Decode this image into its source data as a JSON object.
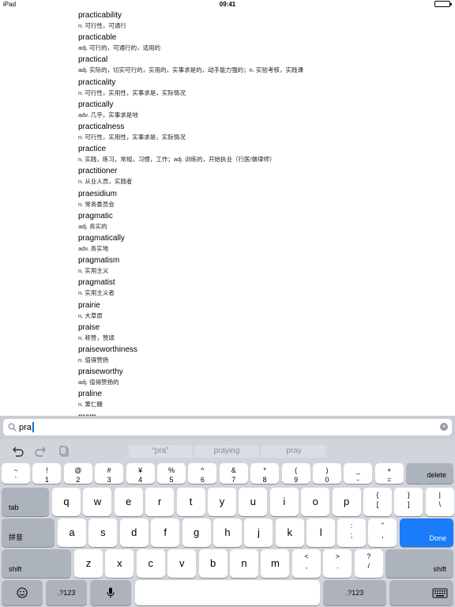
{
  "status": {
    "device": "iPad",
    "time": "09:41"
  },
  "entries": [
    {
      "word": "practicability",
      "def": "n. 可行性，可通行"
    },
    {
      "word": "practicable",
      "def": "adj. 可行的，可通行的，适用的"
    },
    {
      "word": "practical",
      "def": "adj. 实际的，切实可行的，实用的，实事求是的，动手能力强的；n. 实验考核，实践课"
    },
    {
      "word": "practicality",
      "def": "n. 可行性，实用性，实事求是，实际情况"
    },
    {
      "word": "practically",
      "def": "adv. 几乎，实事求是地"
    },
    {
      "word": "practicalness",
      "def": "n. 可行性，实用性，实事求是，实际情况"
    },
    {
      "word": "practice",
      "def": "n. 实践，练习，常规，习惯，工作；adj. 训练的，开始执业（行医/做律师）"
    },
    {
      "word": "practitioner",
      "def": "n. 从业人员，实践者"
    },
    {
      "word": "praesidium",
      "def": "n. 常务委员会"
    },
    {
      "word": "pragmatic",
      "def": "adj. 务实的"
    },
    {
      "word": "pragmatically",
      "def": "adv. 务实地"
    },
    {
      "word": "pragmatism",
      "def": "n. 实用主义"
    },
    {
      "word": "pragmatist",
      "def": "n. 实用主义者"
    },
    {
      "word": "prairie",
      "def": "n. 大草原"
    },
    {
      "word": "praise",
      "def": "n. 称赞，赞颂"
    },
    {
      "word": "praiseworthiness",
      "def": "n. 值得赞扬"
    },
    {
      "word": "praiseworthy",
      "def": "adj. 值得赞扬的"
    },
    {
      "word": "praline",
      "def": "n. 果仁糖"
    },
    {
      "word": "pram",
      "def": ""
    }
  ],
  "search": {
    "value": "pra"
  },
  "candidates": [
    "“pra”",
    "praying",
    "pray"
  ],
  "keyboard": {
    "row1": [
      {
        "top": "~",
        "bottom": "`"
      },
      {
        "top": "!",
        "bottom": "1"
      },
      {
        "top": "@",
        "bottom": "2"
      },
      {
        "top": "#",
        "bottom": "3"
      },
      {
        "top": "¥",
        "bottom": "4"
      },
      {
        "top": "%",
        "bottom": "5"
      },
      {
        "top": "^",
        "bottom": "6"
      },
      {
        "top": "&",
        "bottom": "7"
      },
      {
        "top": "*",
        "bottom": "8"
      },
      {
        "top": "(",
        "bottom": "9"
      },
      {
        "top": ")",
        "bottom": "0"
      },
      {
        "top": "_",
        "bottom": "-"
      },
      {
        "top": "+",
        "bottom": "="
      }
    ],
    "delete": "delete",
    "tab": "tab",
    "row2": [
      "q",
      "w",
      "e",
      "r",
      "t",
      "y",
      "u",
      "i",
      "o",
      "p"
    ],
    "row2_extra": [
      {
        "top": "{",
        "bottom": "["
      },
      {
        "top": "}",
        "bottom": "]"
      },
      {
        "top": "|",
        "bottom": "\\"
      }
    ],
    "pinyin": "拼音",
    "row3": [
      "a",
      "s",
      "d",
      "f",
      "g",
      "h",
      "j",
      "k",
      "l"
    ],
    "row3_extra": [
      {
        "top": ":",
        "bottom": ";"
      },
      {
        "top": "”",
        "bottom": ","
      }
    ],
    "done": "Done",
    "shift": "shift",
    "row4": [
      "z",
      "x",
      "c",
      "v",
      "b",
      "n",
      "m"
    ],
    "row4_extra": [
      {
        "top": "<",
        "bottom": ","
      },
      {
        "top": ">",
        "bottom": "."
      },
      {
        "top": "?",
        "bottom": "/"
      }
    ],
    "numbers": ".?123"
  }
}
